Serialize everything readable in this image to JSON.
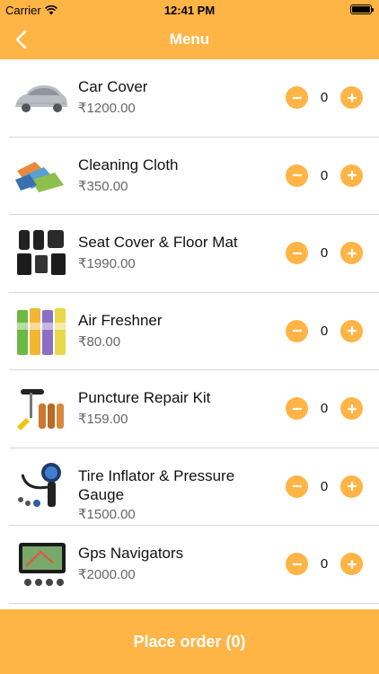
{
  "status": {
    "carrier": "Carrier",
    "time": "12:41 PM"
  },
  "nav": {
    "title": "Menu"
  },
  "items": [
    {
      "name": "Car Cover",
      "price": "₹1200.00",
      "qty": "0"
    },
    {
      "name": "Cleaning Cloth",
      "price": "₹350.00",
      "qty": "0"
    },
    {
      "name": "Seat Cover & Floor Mat",
      "price": "₹1990.00",
      "qty": "0"
    },
    {
      "name": "Air Freshner",
      "price": "₹80.00",
      "qty": "0"
    },
    {
      "name": "Puncture Repair Kit",
      "price": "₹159.00",
      "qty": "0"
    },
    {
      "name": "Tire Inflator & Pressure Gauge",
      "price": "₹1500.00",
      "qty": "0"
    },
    {
      "name": "Gps Navigators",
      "price": "₹2000.00",
      "qty": "0"
    }
  ],
  "footer": {
    "label": "Place order (0)"
  },
  "colors": {
    "accent": "#ffb446"
  }
}
